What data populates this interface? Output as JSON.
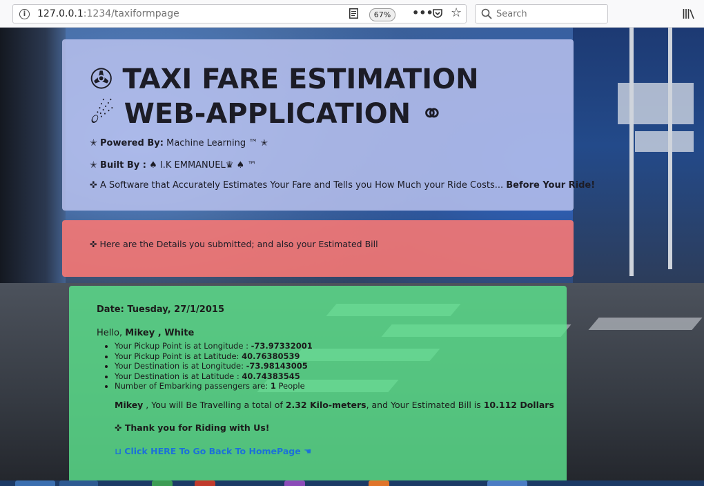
{
  "browser": {
    "url_host": "127.0.0.1",
    "url_rest": ":1234/taxiformpage",
    "zoom": "67%",
    "search_placeholder": "Search",
    "icons": [
      "info-icon",
      "reader-view-icon",
      "more-icon",
      "pocket-icon",
      "star-icon",
      "search-icon",
      "library-icon"
    ]
  },
  "header": {
    "title_line1": "✇ TAXI FARE ESTIMATION",
    "title_line2": "☄ WEB-APPLICATION ⚭",
    "powered_prefix": "✭ ",
    "powered_label": "Powered By:",
    "powered_value": " Machine Learning ™ ✭",
    "built_prefix": "✭ ",
    "built_label": "Built By :",
    "built_value": " ♠ I.K EMMANUEL♛ ♠ ™",
    "tagline": "✜ A Software that Accurately Estimates Your Fare and Tells you How Much your Ride Costs... ",
    "tagline_bold": "Before Your Ride!"
  },
  "notice": {
    "text": "✜ Here are the Details you submitted; and also your Estimated Bill"
  },
  "bill": {
    "date": "Date: Tuesday, 27/1/2015",
    "hello": "Hello, ",
    "name": "Mikey , White",
    "details": [
      {
        "label": "Your Pickup Point is at Longitude : ",
        "value": "-73.97332001",
        "suffix": ""
      },
      {
        "label": "Your Pickup Point is at Latitude: ",
        "value": "40.76380539",
        "suffix": ""
      },
      {
        "label": "Your Destination is at Longitude: ",
        "value": "-73.98143005",
        "suffix": ""
      },
      {
        "label": "Your Destination is at Latitude : ",
        "value": "40.74383545",
        "suffix": ""
      },
      {
        "label": "Number of Embarking passengers are: ",
        "value": "1",
        "suffix": " People"
      }
    ],
    "summary_name": "Mikey",
    "summary_text1": " , You will Be Travelling a total of ",
    "summary_distance": "2.32 Kilo-meters",
    "summary_text2": ", and Your Estimated Bill is ",
    "summary_bill": "10.112 Dollars",
    "thanks": "✜ Thank you for Riding with Us!",
    "back_link": "⊔ Click HERE To Go Back To HomePage ☚"
  },
  "colors": {
    "header_panel": "#b8c0ec",
    "notice_panel": "#f67874",
    "bill_panel": "#5ce28c",
    "link": "#1c71d8"
  }
}
